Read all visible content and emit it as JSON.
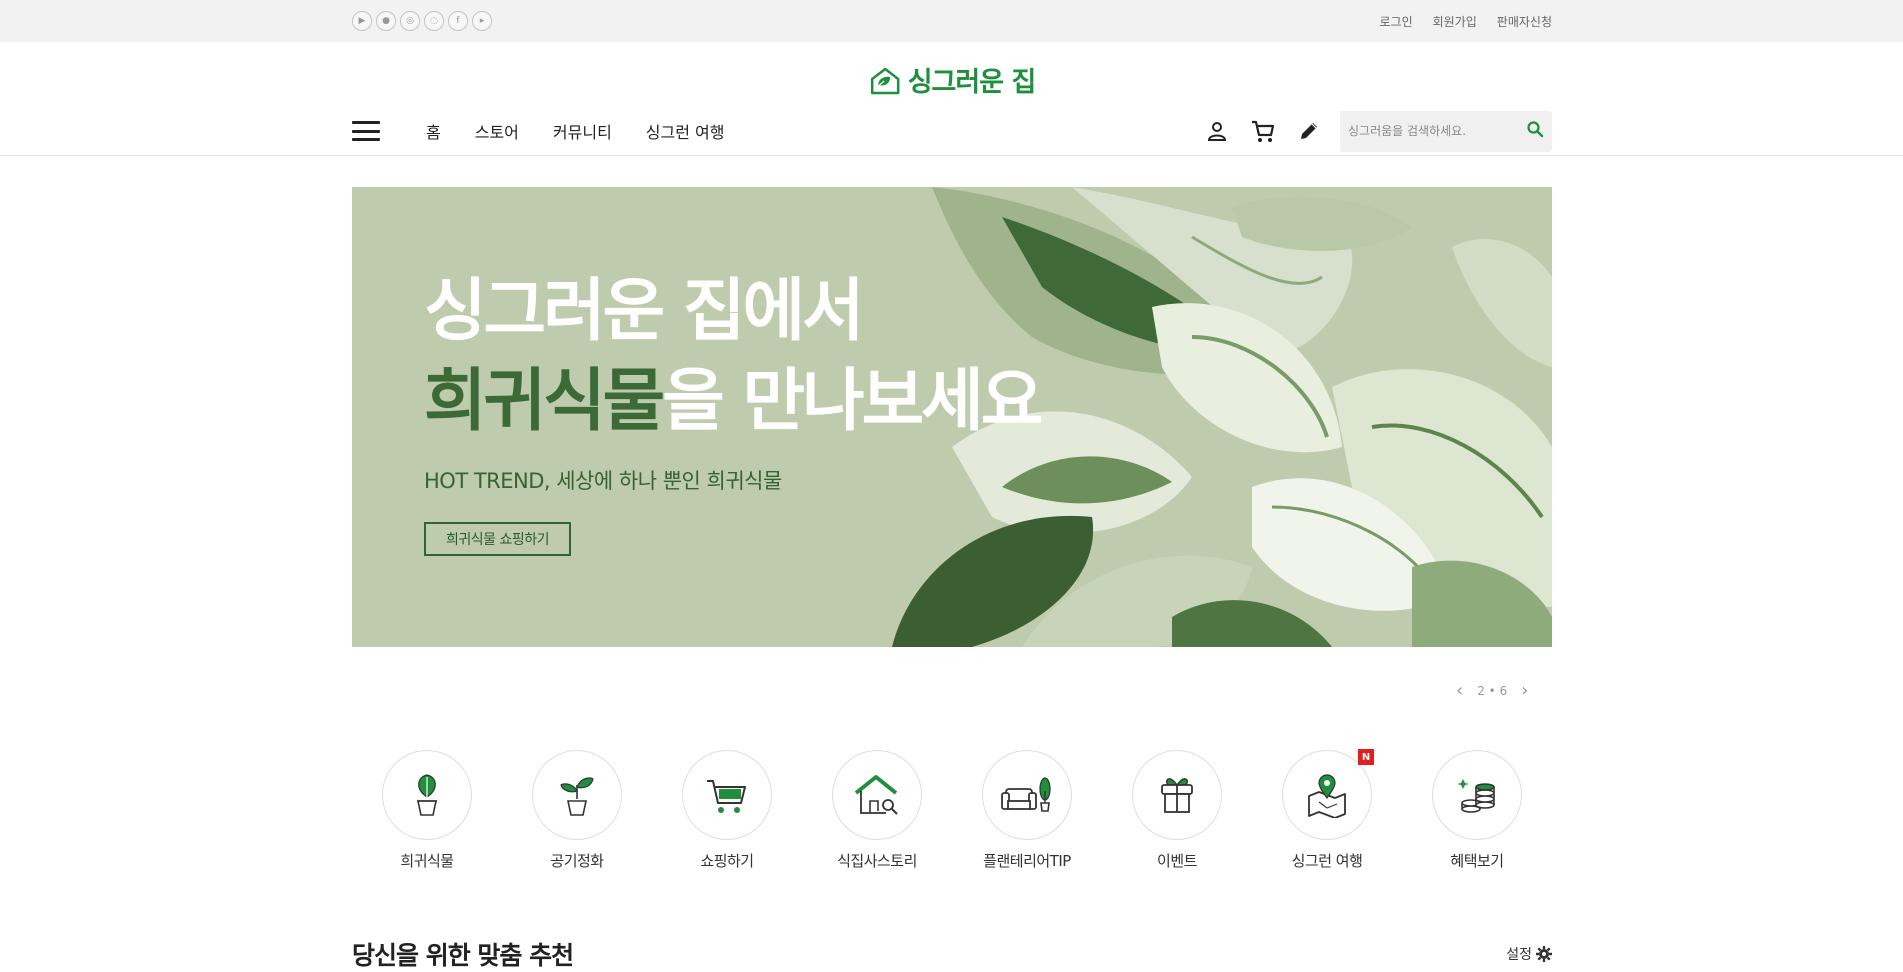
{
  "topbar": {
    "social_icons": [
      "google-play-icon",
      "apple-icon",
      "instagram-icon",
      "chat-icon",
      "facebook-icon",
      "youtube-icon"
    ],
    "links": [
      "로그인",
      "회원가입",
      "판매자신청"
    ]
  },
  "header": {
    "logo_text": "싱그러운 집",
    "menu": [
      "홈",
      "스토어",
      "커뮤니티",
      "싱그런 여행"
    ],
    "icons": [
      "user-icon",
      "cart-icon",
      "pencil-icon"
    ],
    "search_placeholder": "싱그러움을 검색하세요."
  },
  "banner": {
    "headline_line1": "싱그러운 집에서",
    "headline_highlight": "희귀식물",
    "headline_line2_rest": "을 만나보세요",
    "subtitle": "HOT TREND, 세상에 하나 뿐인 희귀식물",
    "cta": "희귀식물 쇼핑하기",
    "background_color": "#bfcbad"
  },
  "pager": {
    "current": "2",
    "total": "6"
  },
  "categories": [
    {
      "label": "희귀식물",
      "icon": "monstera-pot-icon"
    },
    {
      "label": "공기정화",
      "icon": "sprout-pot-icon"
    },
    {
      "label": "쇼핑하기",
      "icon": "cart-icon"
    },
    {
      "label": "식집사스토리",
      "icon": "house-search-icon"
    },
    {
      "label": "플랜테리어TIP",
      "icon": "sofa-plant-icon"
    },
    {
      "label": "이벤트",
      "icon": "gift-icon"
    },
    {
      "label": "싱그런 여행",
      "icon": "map-pin-icon",
      "badge": "N"
    },
    {
      "label": "혜택보기",
      "icon": "coins-icon"
    }
  ],
  "recommend": {
    "title": "당신을 위한 맞춤 추천",
    "settings": "설정"
  },
  "colors": {
    "brand_green": "#1f8f3e",
    "dark_green": "#356433",
    "badge_red": "#e02020"
  }
}
